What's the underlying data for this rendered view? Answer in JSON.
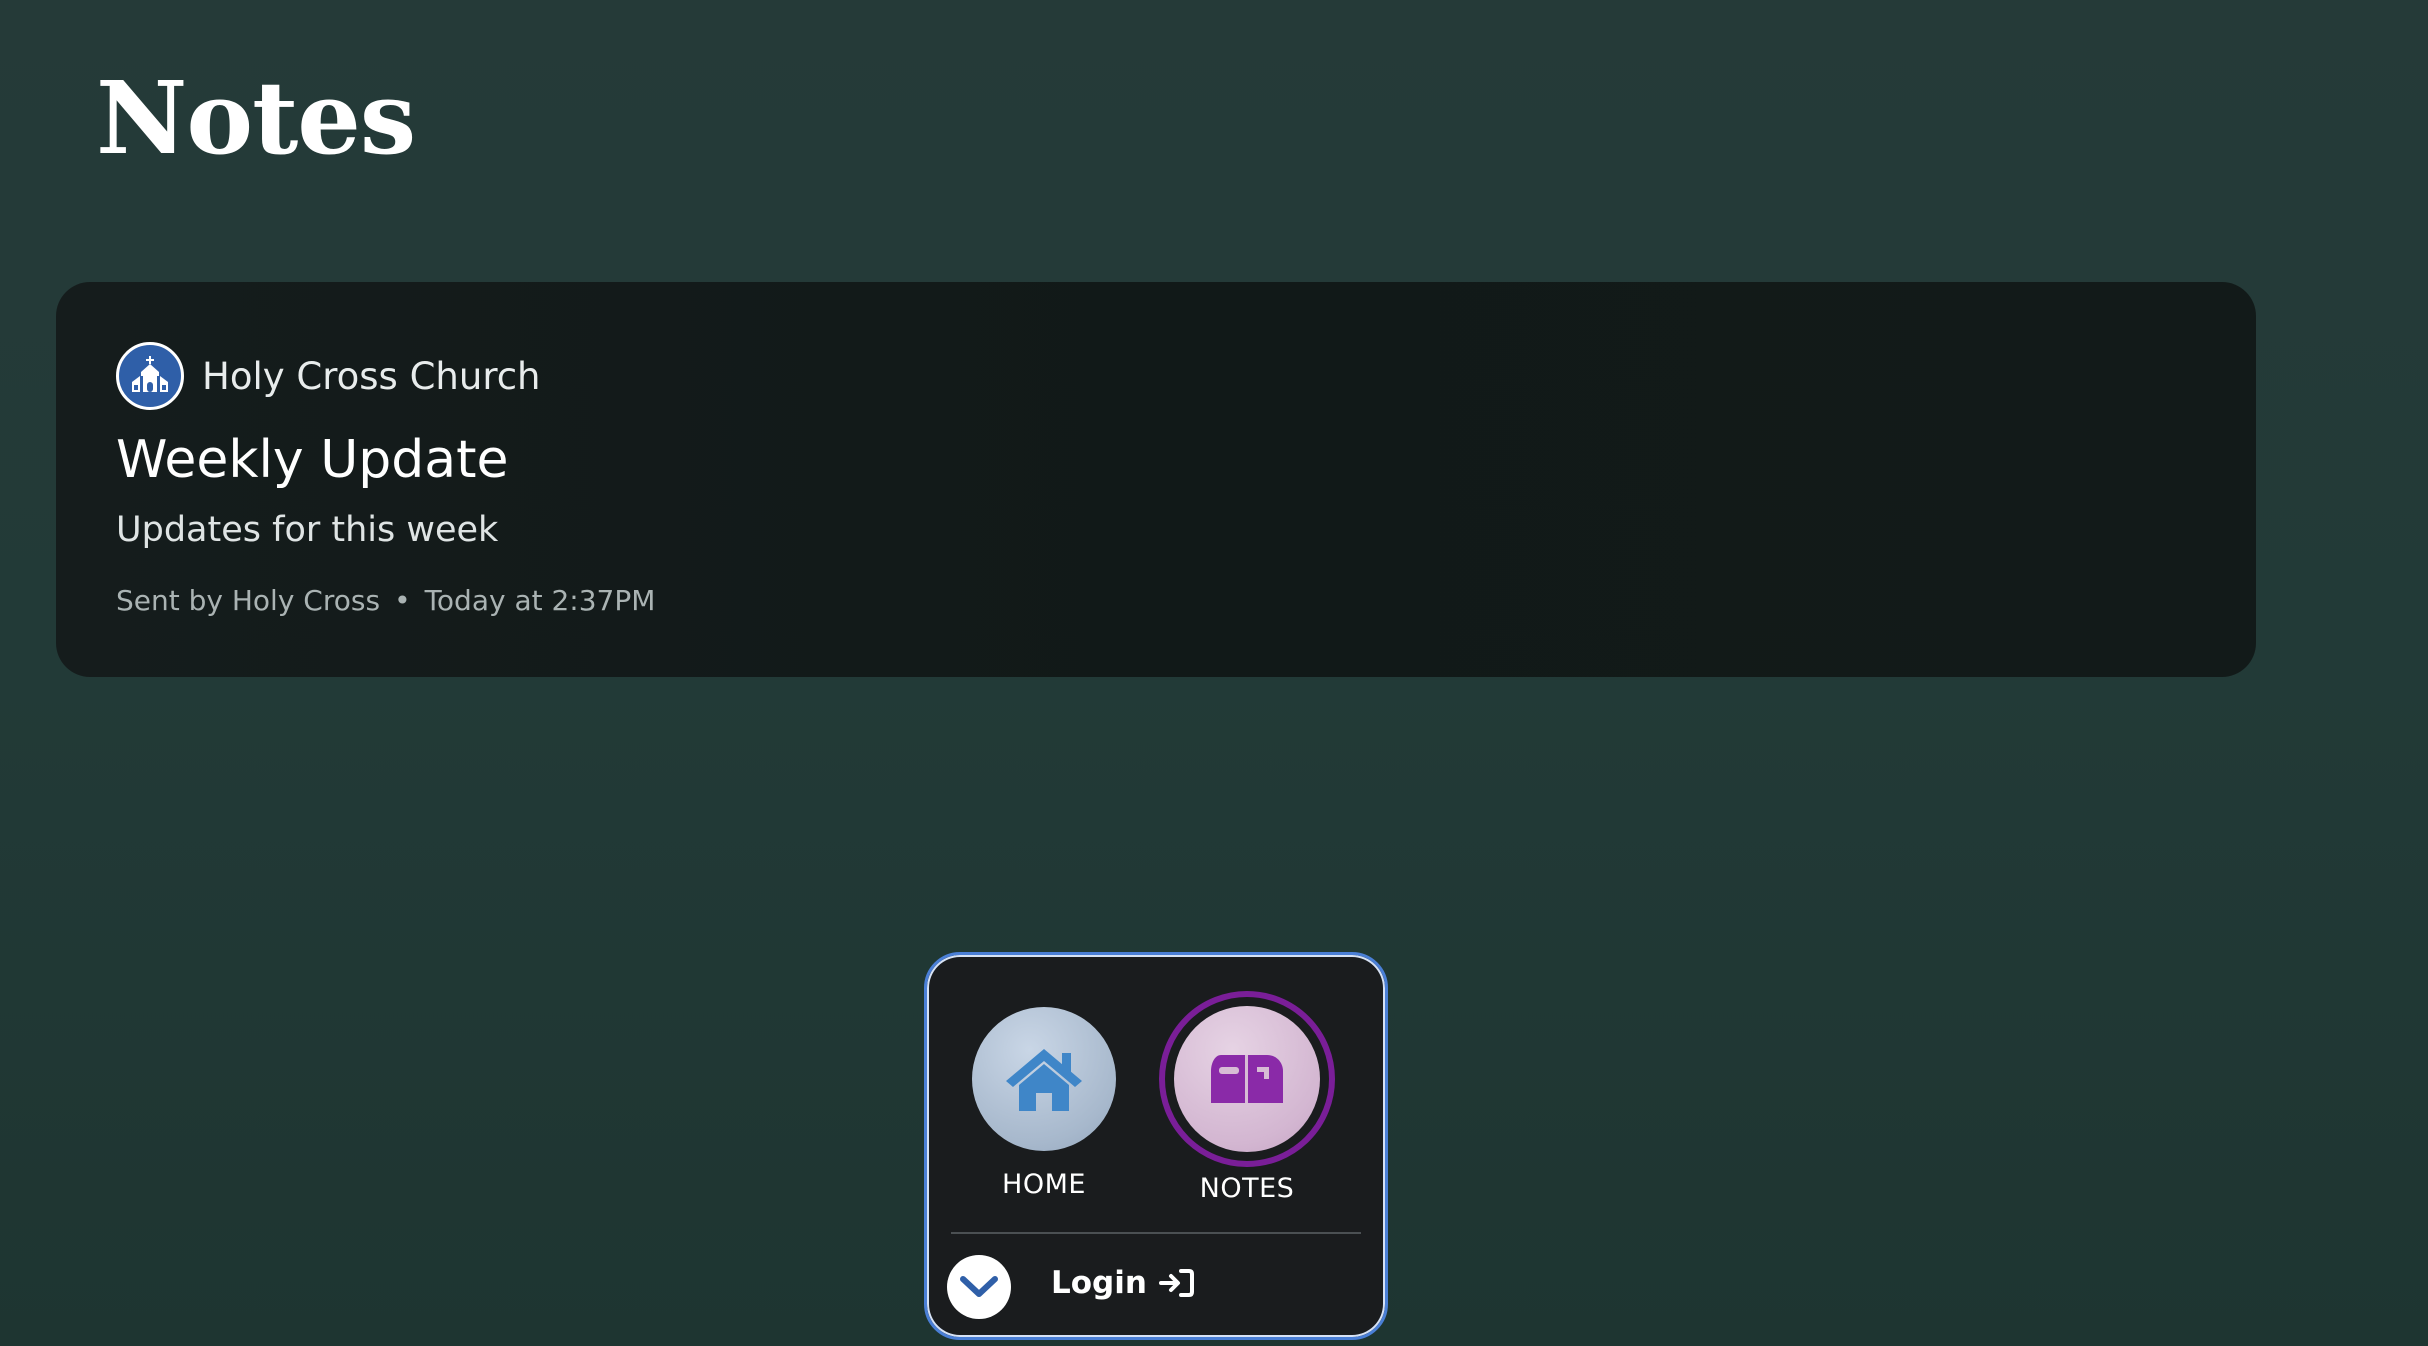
{
  "page": {
    "title": "Notes"
  },
  "note": {
    "org_name": "Holy Cross Church",
    "org_icon": "church-icon",
    "title": "Weekly Update",
    "subtitle": "Updates for this week",
    "sender": "Sent by Holy Cross",
    "separator": "•",
    "timestamp": "Today at 2:37PM"
  },
  "nav": {
    "home": {
      "label": "HOME",
      "icon": "house-icon"
    },
    "notes": {
      "label": "NOTES",
      "icon": "mailbox-icon",
      "active": true
    },
    "collapse_icon": "chevron-down-icon",
    "login": {
      "label": "Login",
      "icon": "sign-in-icon"
    }
  },
  "colors": {
    "accent_blue": "#4a7fd6",
    "notes_ring": "#7a1e98",
    "notes_icon": "#8a2aa8",
    "home_icon": "#3f86c8",
    "church_avatar": "#2f5fa8"
  }
}
